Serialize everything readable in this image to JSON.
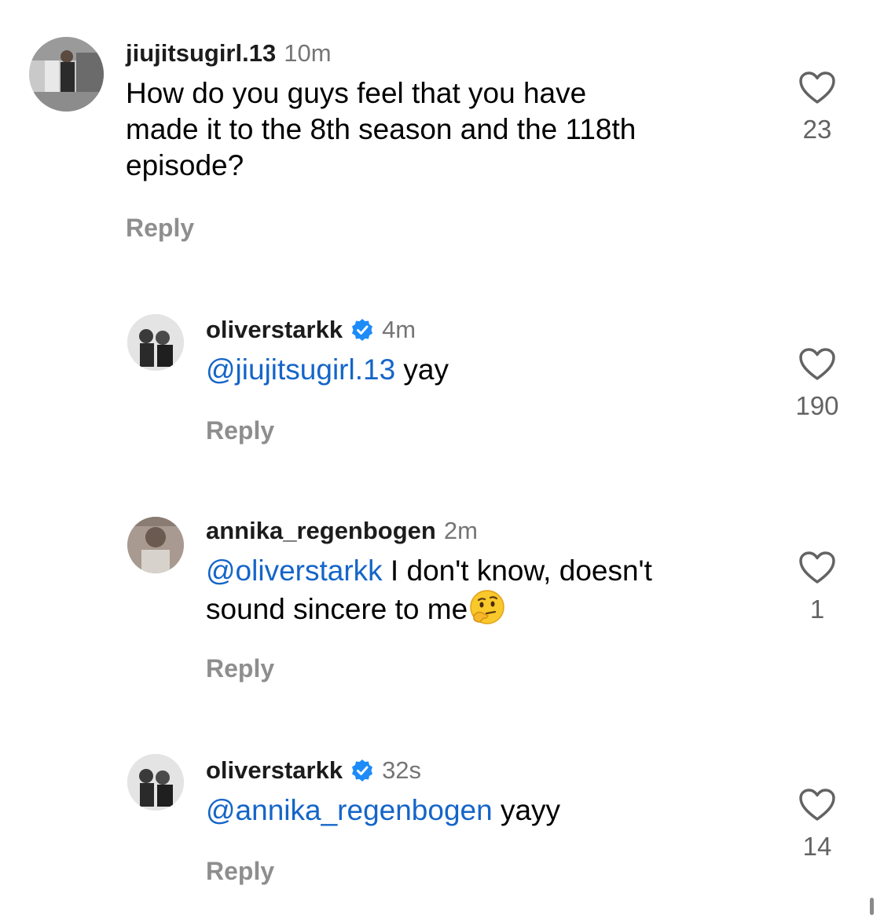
{
  "comments": [
    {
      "username": "jiujitsugirl.13",
      "time": "10m",
      "lines": [
        "How do you guys feel that you  have",
        "made it to the 8th season and the 118th",
        "episode?"
      ],
      "reply_label": "Reply",
      "likes": "23",
      "verified": false
    },
    {
      "username": "oliverstarkk",
      "time": "4m",
      "mention": "@jiujitsugirl.13",
      "text": " yay",
      "reply_label": "Reply",
      "likes": "190",
      "verified": true
    },
    {
      "username": "annika_regenbogen",
      "time": "2m",
      "mention": "@oliverstarkk",
      "line1": " I don't know, doesn't",
      "line2": "sound sincere to me",
      "emoji": "thinking-face-emoji",
      "reply_label": "Reply",
      "likes": "1",
      "verified": false
    },
    {
      "username": "oliverstarkk",
      "time": "32s",
      "mention": "@annika_regenbogen",
      "text": " yayy",
      "reply_label": "Reply",
      "likes": "14",
      "verified": true
    }
  ],
  "colors": {
    "mention": "#1565c8",
    "verified_badge": "#1d8cf8",
    "secondary_text": "#8e8e8e",
    "heart_outline": "#636363"
  },
  "icons": {
    "like": "heart-outline-icon",
    "verified": "verified-badge-icon"
  }
}
